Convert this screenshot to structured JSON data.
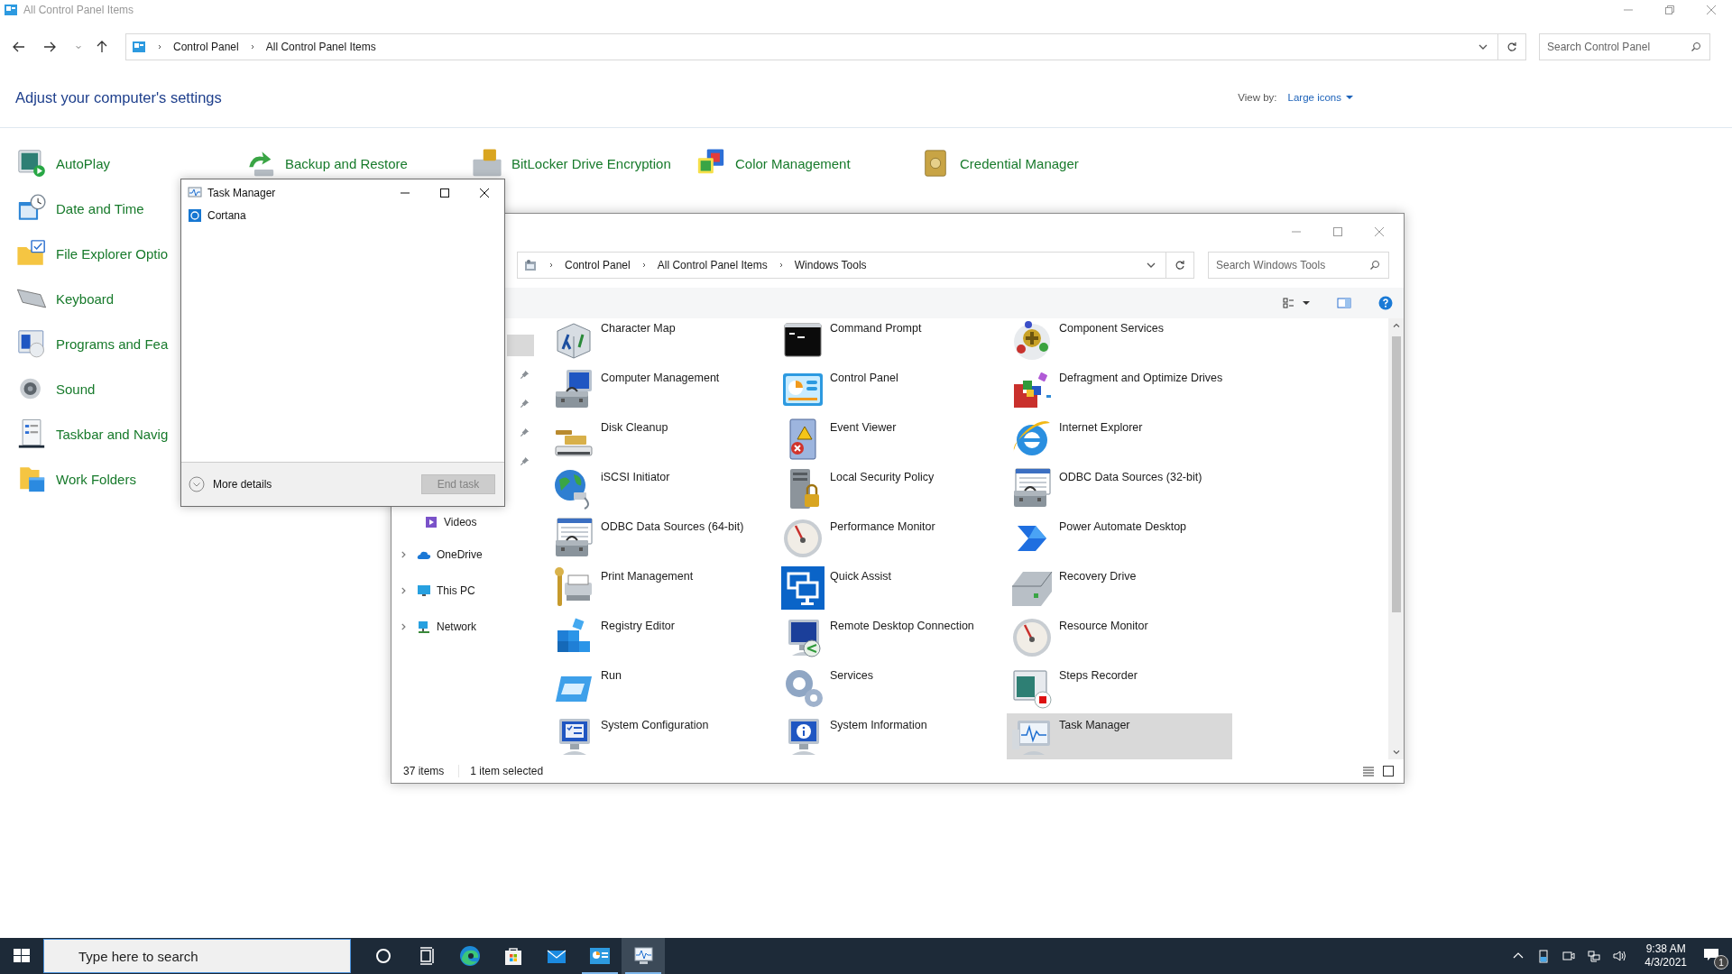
{
  "control_panel": {
    "title": "All Control Panel Items",
    "breadcrumb": [
      "Control Panel",
      "All Control Panel Items"
    ],
    "search": {
      "placeholder": "Search Control Panel"
    },
    "heading": "Adjust your computer's settings",
    "view_by": {
      "label": "View by:",
      "value": "Large icons"
    },
    "rows": [
      [
        "AutoPlay",
        "Backup and Restore",
        "BitLocker Drive Encryption",
        "Color Management",
        "Credential Manager"
      ],
      [
        "Date and Time"
      ],
      [
        "File Explorer Optio"
      ],
      [
        "Keyboard"
      ],
      [
        "Programs and Fea"
      ],
      [
        "Sound"
      ],
      [
        "Taskbar and Navig"
      ],
      [
        "Work Folders"
      ]
    ]
  },
  "tools_window": {
    "breadcrumb": [
      "Control Panel",
      "All Control Panel Items",
      "Windows Tools"
    ],
    "search": {
      "placeholder": "Search Windows Tools"
    },
    "quick_access": [
      {
        "selected": true,
        "pinned": false
      },
      {
        "selected": false,
        "pinned": true
      },
      {
        "selected": false,
        "pinned": true
      },
      {
        "selected": false,
        "pinned": true
      },
      {
        "selected": false,
        "pinned": true
      }
    ],
    "nav": [
      {
        "label": "Videos",
        "expandable": false
      },
      {
        "label": "OneDrive",
        "expandable": true
      },
      {
        "label": "This PC",
        "expandable": true
      },
      {
        "label": "Network",
        "expandable": true
      }
    ],
    "items": [
      {
        "label": "Character Map",
        "selected": false
      },
      {
        "label": "Command Prompt",
        "selected": false
      },
      {
        "label": "Component Services",
        "selected": false
      },
      {
        "label": "Computer Management",
        "selected": false
      },
      {
        "label": "Control Panel",
        "selected": false
      },
      {
        "label": "Defragment and Optimize Drives",
        "selected": false
      },
      {
        "label": "Disk Cleanup",
        "selected": false
      },
      {
        "label": "Event Viewer",
        "selected": false
      },
      {
        "label": "Internet Explorer",
        "selected": false
      },
      {
        "label": "iSCSI Initiator",
        "selected": false
      },
      {
        "label": "Local Security Policy",
        "selected": false
      },
      {
        "label": "ODBC Data Sources (32-bit)",
        "selected": false
      },
      {
        "label": "ODBC Data Sources (64-bit)",
        "selected": false
      },
      {
        "label": "Performance Monitor",
        "selected": false
      },
      {
        "label": "Power Automate Desktop",
        "selected": false
      },
      {
        "label": "Print Management",
        "selected": false
      },
      {
        "label": "Quick Assist",
        "selected": false
      },
      {
        "label": "Recovery Drive",
        "selected": false
      },
      {
        "label": "Registry Editor",
        "selected": false
      },
      {
        "label": "Remote Desktop Connection",
        "selected": false
      },
      {
        "label": "Resource Monitor",
        "selected": false
      },
      {
        "label": "Run",
        "selected": false
      },
      {
        "label": "Services",
        "selected": false
      },
      {
        "label": "Steps Recorder",
        "selected": false
      },
      {
        "label": "System Configuration",
        "selected": false
      },
      {
        "label": "System Information",
        "selected": false
      },
      {
        "label": "Task Manager",
        "selected": true
      }
    ],
    "status": {
      "count": "37 items",
      "selection": "1 item selected"
    }
  },
  "task_manager": {
    "title": "Task Manager",
    "apps": [
      {
        "label": "Cortana"
      }
    ],
    "more_details": "More details",
    "end_task": {
      "label": "End task",
      "disabled": true
    }
  },
  "taskbar": {
    "search": {
      "placeholder": "Type here to search"
    },
    "apps": [
      {
        "running": false,
        "active": false
      },
      {
        "running": false,
        "active": false
      },
      {
        "running": false,
        "active": false
      },
      {
        "running": true,
        "active": false
      },
      {
        "running": true,
        "active": true
      }
    ],
    "time": "9:38 AM",
    "date": "4/3/2021",
    "notifications": "1"
  }
}
